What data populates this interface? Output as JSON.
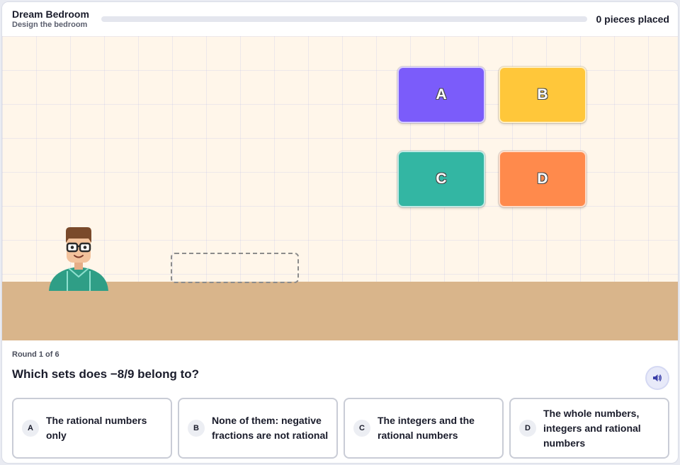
{
  "header": {
    "title": "Dream Bedroom",
    "subtitle": "Design the bedroom",
    "pieces_label": "0 pieces placed",
    "progress": 0
  },
  "tiles": [
    {
      "label": "A",
      "color": "#7b5cfa"
    },
    {
      "label": "B",
      "color": "#ffc73a"
    },
    {
      "label": "C",
      "color": "#33b6a3"
    },
    {
      "label": "D",
      "color": "#ff8a4c"
    }
  ],
  "question": {
    "round": "Round 1 of 6",
    "text": "Which sets does −8/9 belong to?"
  },
  "answers": [
    {
      "letter": "A",
      "text": "The rational numbers only"
    },
    {
      "letter": "B",
      "text": "None of them: negative fractions are not rational"
    },
    {
      "letter": "C",
      "text": "The integers and the rational numbers"
    },
    {
      "letter": "D",
      "text": "The whole numbers, integers and rational numbers"
    }
  ],
  "icons": {
    "audio": "speaker-icon",
    "avatar": "character-avatar"
  },
  "colors": {
    "accent": "#6d5efc",
    "floor": "#d9b58b",
    "wall": "#fff6ea"
  }
}
